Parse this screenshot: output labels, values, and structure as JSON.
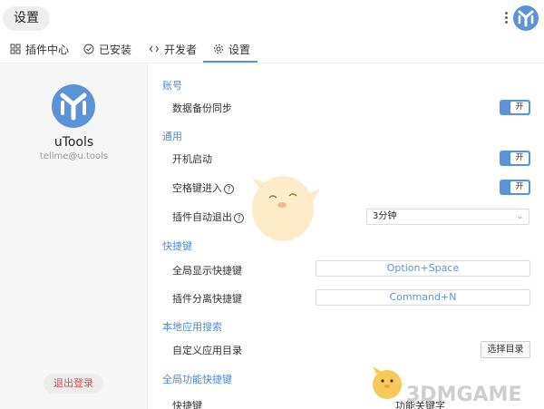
{
  "window": {
    "title": "设置"
  },
  "tabs": [
    {
      "label": "插件中心",
      "icon": "grid-icon"
    },
    {
      "label": "已安装",
      "icon": "check-circle-icon"
    },
    {
      "label": "开发者",
      "icon": "code-icon"
    },
    {
      "label": "设置",
      "icon": "gear-icon",
      "active": true
    }
  ],
  "user": {
    "name": "uTools",
    "email": "tellme@u.tools",
    "logout_label": "退出登录"
  },
  "sections": {
    "account": {
      "title": "账号",
      "backup_label": "数据备份同步",
      "backup_toggle": "开"
    },
    "general": {
      "title": "通用",
      "startup_label": "开机启动",
      "startup_toggle": "开",
      "space_label": "空格键进入",
      "space_toggle": "开",
      "autoexit_label": "插件自动退出",
      "autoexit_value": "3分钟"
    },
    "shortcuts": {
      "title": "快捷键",
      "show_label": "全局显示快捷键",
      "show_value": "Option+Space",
      "detach_label": "插件分离快捷键",
      "detach_value": "Command+N"
    },
    "local_search": {
      "title": "本地应用搜索",
      "dir_label": "自定义应用目录",
      "dir_button": "选择目录"
    },
    "global_func": {
      "title": "全局功能快捷键",
      "col_shortcut": "快捷键",
      "col_keyword": "功能关键字"
    }
  },
  "watermark": "3DMGAME",
  "colors": {
    "accent": "#5b93d6",
    "danger": "#e34a4a",
    "logo": "#5b93d6"
  }
}
